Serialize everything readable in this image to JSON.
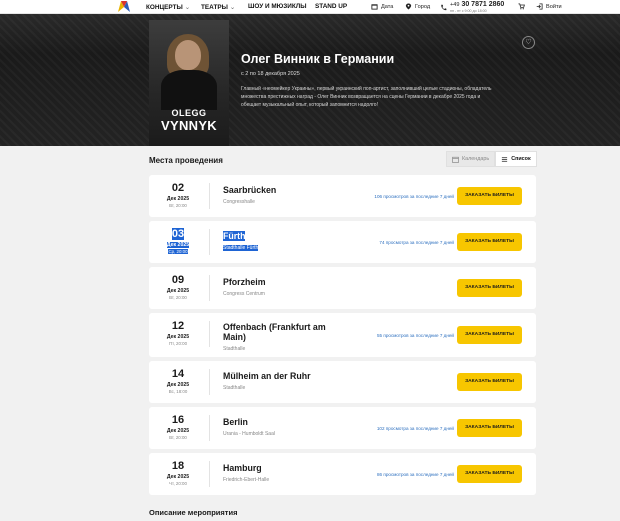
{
  "nav": {
    "items": [
      {
        "label": "КОНЦЕРТЫ",
        "chevron": true
      },
      {
        "label": "ТЕАТРЫ",
        "chevron": true
      },
      {
        "label": "ШОУ И МЮЗИКЛЫ",
        "chevron": false
      },
      {
        "label": "STAND UP",
        "chevron": false
      }
    ],
    "date_label": "Дата",
    "city_label": "Город",
    "phone": "+49 30 7871 2860",
    "phone_prefix": "+49",
    "phone_number": "30 7871 2860",
    "phone_hours": "пн - пт с 9:00 до 18:00",
    "login_label": "Войти"
  },
  "hero": {
    "poster_line1": "OLEGG",
    "poster_line2": "VYNNYK",
    "title": "Олег Винник в Германии",
    "dates": "с 2 по 18 декабря 2025",
    "description": "Главный «неомейкер Украины», первый украинский поп-артист, заполнивший целые стадионы, обладатель множества престижных наград - Олег Винник возвращается на сцены Германии в декабре 2025 года и обещает музыкальный опыт, который запомнится надолго!"
  },
  "venues": {
    "title": "Места проведения",
    "view_calendar": "Календарь",
    "view_list": "Список",
    "buy_label": "ЗАКАЗАТЬ БИЛЕТЫ",
    "events": [
      {
        "day": "02",
        "month": "Дек 2025",
        "weekday": "Вт, 20:00",
        "city": "Saarbrücken",
        "venue": "Congresshalle",
        "views": "106 просмотров за последние 7 дней"
      },
      {
        "day": "03",
        "month": "Дек 2025",
        "weekday": "Ср, 20:00",
        "city": "Fürth",
        "venue": "Stadthalle Fürth",
        "views": "74 просмотра за последние 7 дней"
      },
      {
        "day": "09",
        "month": "Дек 2025",
        "weekday": "Вт, 20:00",
        "city": "Pforzheim",
        "venue": "Congress Centrum",
        "views": ""
      },
      {
        "day": "12",
        "month": "Дек 2025",
        "weekday": "Пт, 20:00",
        "city": "Offenbach (Frankfurt am Main)",
        "venue": "Stadthalle",
        "views": "55 просмотров за последние 7 дней"
      },
      {
        "day": "14",
        "month": "Дек 2025",
        "weekday": "Вс, 18:00",
        "city": "Mülheim an der Ruhr",
        "venue": "Stadthalle",
        "views": ""
      },
      {
        "day": "16",
        "month": "Дек 2025",
        "weekday": "Вт, 20:00",
        "city": "Berlin",
        "venue": "Urania - Humboldt Saal",
        "views": "102 просмотра за последние 7 дней"
      },
      {
        "day": "18",
        "month": "Дек 2025",
        "weekday": "Чт, 20:00",
        "city": "Hamburg",
        "venue": "Friedrich-Ebert-Halle",
        "views": "86 просмотров за последние 7 дней"
      }
    ]
  },
  "description_section": {
    "title": "Описание мероприятия"
  },
  "colors": {
    "accent": "#f7c600",
    "link": "#2c6fbf",
    "selection": "#1e64d4"
  }
}
